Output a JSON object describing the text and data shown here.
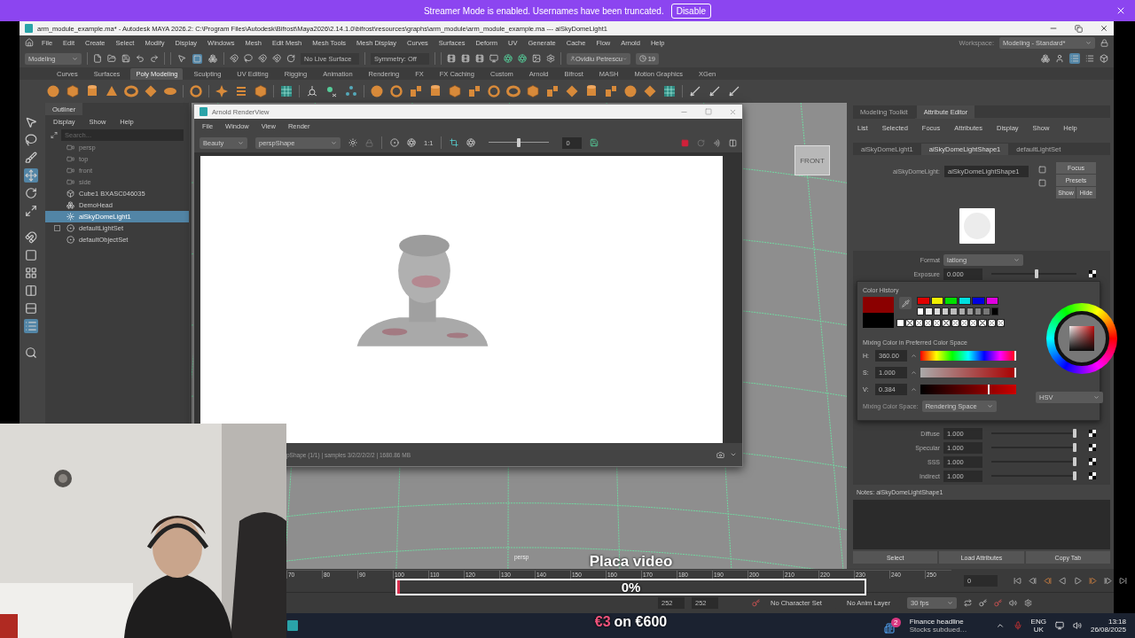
{
  "streamer_banner": {
    "message": "Streamer Mode is enabled. Usernames have been truncated.",
    "button": "Disable"
  },
  "window": {
    "title": "arm_module_example.ma* - Autodesk MAYA 2026.2: C:\\Program Files\\Autodesk\\Bifrost\\Maya2026\\2.14.1.0\\bifrost\\resources\\graphs\\arm_module\\arm_module_example.ma  ---  aiSkyDomeLight1"
  },
  "menu_bar": {
    "items": [
      "File",
      "Edit",
      "Create",
      "Select",
      "Modify",
      "Display",
      "Windows",
      "Mesh",
      "Edit Mesh",
      "Mesh Tools",
      "Mesh Display",
      "Curves",
      "Surfaces",
      "Deform",
      "UV",
      "Generate",
      "Cache",
      "Flow",
      "Arnold",
      "Help"
    ],
    "workspace_label": "Workspace:",
    "workspace_value": "Modeling - Standard*"
  },
  "status_line": {
    "mode": "Modeling",
    "live_surface": "No Live Surface",
    "symmetry": "Symmetry: Off",
    "user": "Ovidiu Petrescu",
    "notifications": "19"
  },
  "shelf": {
    "tabs": [
      {
        "label": "Curves",
        "selected": false
      },
      {
        "label": "Surfaces",
        "selected": false
      },
      {
        "label": "Poly Modeling",
        "selected": true
      },
      {
        "label": "Sculpting",
        "selected": false
      },
      {
        "label": "UV Editing",
        "selected": false
      },
      {
        "label": "Rigging",
        "selected": false
      },
      {
        "label": "Animation",
        "selected": false
      },
      {
        "label": "Rendering",
        "selected": false
      },
      {
        "label": "FX",
        "selected": false
      },
      {
        "label": "FX Caching",
        "selected": false
      },
      {
        "label": "Custom",
        "selected": false
      },
      {
        "label": "Arnold",
        "selected": false
      },
      {
        "label": "Bifrost",
        "selected": false
      },
      {
        "label": "MASH",
        "selected": false
      },
      {
        "label": "Motion Graphics",
        "selected": false
      },
      {
        "label": "XGen",
        "selected": false
      }
    ]
  },
  "toolbox": {
    "tools": [
      {
        "kind": "select",
        "selected": false
      },
      {
        "kind": "lasso",
        "selected": false
      },
      {
        "kind": "paint",
        "selected": false
      },
      {
        "kind": "move",
        "selected": true
      },
      {
        "kind": "rotate",
        "selected": false
      },
      {
        "kind": "scale",
        "selected": false
      },
      {
        "kind": "snap",
        "selected": false
      },
      {
        "kind": "single",
        "selected": false
      },
      {
        "kind": "four",
        "selected": false
      },
      {
        "kind": "columns",
        "selected": false
      },
      {
        "kind": "rows",
        "selected": false
      },
      {
        "kind": "outliner",
        "selected": true
      },
      {
        "kind": "search",
        "selected": false
      }
    ]
  },
  "outliner": {
    "title": "Outliner",
    "menus": [
      "Display",
      "Show",
      "Help"
    ],
    "search_placeholder": "Search...",
    "items": [
      {
        "kind": "camera",
        "label": "persp",
        "hidden": true,
        "selected": false,
        "expandable": false
      },
      {
        "kind": "camera",
        "label": "top",
        "hidden": true,
        "selected": false,
        "expandable": false
      },
      {
        "kind": "camera",
        "label": "front",
        "hidden": true,
        "selected": false,
        "expandable": false
      },
      {
        "kind": "camera",
        "label": "side",
        "hidden": true,
        "selected": false,
        "expandable": false
      },
      {
        "kind": "mesh",
        "label": "Cube1 BXASC046035",
        "hidden": false,
        "selected": false,
        "expandable": false
      },
      {
        "kind": "group",
        "label": "DemoHead",
        "hidden": false,
        "selected": false,
        "expandable": false
      },
      {
        "kind": "light",
        "label": "aiSkyDomeLight1",
        "hidden": false,
        "selected": true,
        "expandable": false
      },
      {
        "kind": "set",
        "label": "defaultLightSet",
        "hidden": false,
        "selected": false,
        "expandable": true
      },
      {
        "kind": "set",
        "label": "defaultObjectSet",
        "hidden": false,
        "selected": false,
        "expandable": false
      }
    ]
  },
  "viewport": {
    "camera_label": "persp",
    "view_cube": "FRONT"
  },
  "render_view": {
    "title": "Arnold RenderView",
    "menus": [
      "File",
      "Window",
      "View",
      "Render"
    ],
    "aov": "Beauty",
    "camera": "perspShape",
    "ratio": "1:1",
    "exposure": {
      "level": 0.5,
      "value": "0"
    },
    "status": "pShape (1/1) | samples 3/2/2/2/2/2 | 1680.86 MB"
  },
  "attribute_editor": {
    "panel_tabs": [
      {
        "label": "Modeling Toolkit",
        "selected": false
      },
      {
        "label": "Attribute Editor",
        "selected": true
      }
    ],
    "menus": [
      "List",
      "Selected",
      "Focus",
      "Attributes",
      "Display",
      "Show",
      "Help"
    ],
    "node_tabs": [
      {
        "label": "aiSkyDomeLight1",
        "selected": false
      },
      {
        "label": "aiSkyDomeLightShape1",
        "selected": true
      },
      {
        "label": "defaultLightSet",
        "selected": false
      }
    ],
    "node_label": "aiSkyDomeLight:",
    "node_name": "aiSkyDomeLightShape1",
    "buttons": [
      "Focus",
      "Presets",
      "Show",
      "Hide"
    ],
    "attributes_upper": [
      {
        "kind": "dropdown",
        "label": "Format",
        "value": "latlong"
      },
      {
        "kind": "slider",
        "label": "Exposure",
        "value": "0.000",
        "level": 0.53
      }
    ],
    "attributes_lower": [
      {
        "kind": "slider",
        "label": "Diffuse",
        "value": "1.000",
        "level": 0.98
      },
      {
        "kind": "slider",
        "label": "Specular",
        "value": "1.000",
        "level": 0.98
      },
      {
        "kind": "slider",
        "label": "SSS",
        "value": "1.000",
        "level": 0.98
      },
      {
        "kind": "slider",
        "label": "Indirect",
        "value": "1.000",
        "level": 0.98
      }
    ],
    "notes_label": "Notes:  aiSkyDomeLightShape1",
    "footer_buttons": [
      "Select",
      "Load Attributes",
      "Copy Tab"
    ]
  },
  "color_picker": {
    "history_title": "Color History",
    "palette": [
      {
        "color": "#e00000"
      },
      {
        "color": "#f0f000"
      },
      {
        "color": "#00e000"
      },
      {
        "color": "#00e0e0"
      },
      {
        "color": "#0000e0"
      },
      {
        "color": "#e000e0"
      },
      {
        "color": "#ffffff"
      },
      {
        "color": "#eeeeee"
      },
      {
        "color": "#dddddd"
      },
      {
        "color": "#cccccc"
      },
      {
        "color": "#bbbbbb"
      },
      {
        "color": "#aaaaaa"
      },
      {
        "color": "#999999"
      },
      {
        "color": "#888888"
      },
      {
        "color": "#777777"
      },
      {
        "color": "#000000"
      }
    ],
    "history": [
      {
        "kind": "swatch",
        "color": "#ffffff"
      },
      {
        "kind": "empty"
      },
      {
        "kind": "empty"
      },
      {
        "kind": "empty"
      },
      {
        "kind": "empty"
      },
      {
        "kind": "empty"
      },
      {
        "kind": "empty"
      },
      {
        "kind": "empty"
      },
      {
        "kind": "empty"
      },
      {
        "kind": "empty"
      },
      {
        "kind": "empty"
      },
      {
        "kind": "empty"
      }
    ],
    "mixing_title": "Mixing Color in Preferred Color Space",
    "channels": [
      {
        "kind": "hue",
        "label": "H:",
        "value": "360.00",
        "level": 1.0
      },
      {
        "kind": "saturation",
        "label": "S:",
        "value": "1.000",
        "level": 1.0
      },
      {
        "kind": "value",
        "label": "V:",
        "value": "0.384",
        "level": 0.72
      }
    ],
    "mixing_space_label": "Mixing Color Space:",
    "mixing_space": "Rendering Space",
    "model": "HSV"
  },
  "time_slider": {
    "ticks": [
      "70",
      "80",
      "90",
      "100",
      "110",
      "120",
      "130",
      "140",
      "150",
      "160",
      "170",
      "180",
      "190",
      "200",
      "210",
      "220",
      "230",
      "240",
      "250"
    ],
    "current_frame": "0"
  },
  "range_slider": {
    "start": "252",
    "end": "252",
    "character_set": "No Character Set",
    "anim_layer": "No Anim Layer",
    "fps": "30 fps"
  },
  "taskbar": {
    "news_badge": "2",
    "news_title": "Finance headline",
    "news_subtitle": "Stocks subdued…",
    "language": "ENG",
    "region": "UK",
    "time": "13:18",
    "date": "26/08/2025"
  },
  "donation_goal": {
    "title": "Placa video",
    "percent": "0%",
    "level": 0,
    "raised": "€3",
    "goal": "on €600"
  }
}
